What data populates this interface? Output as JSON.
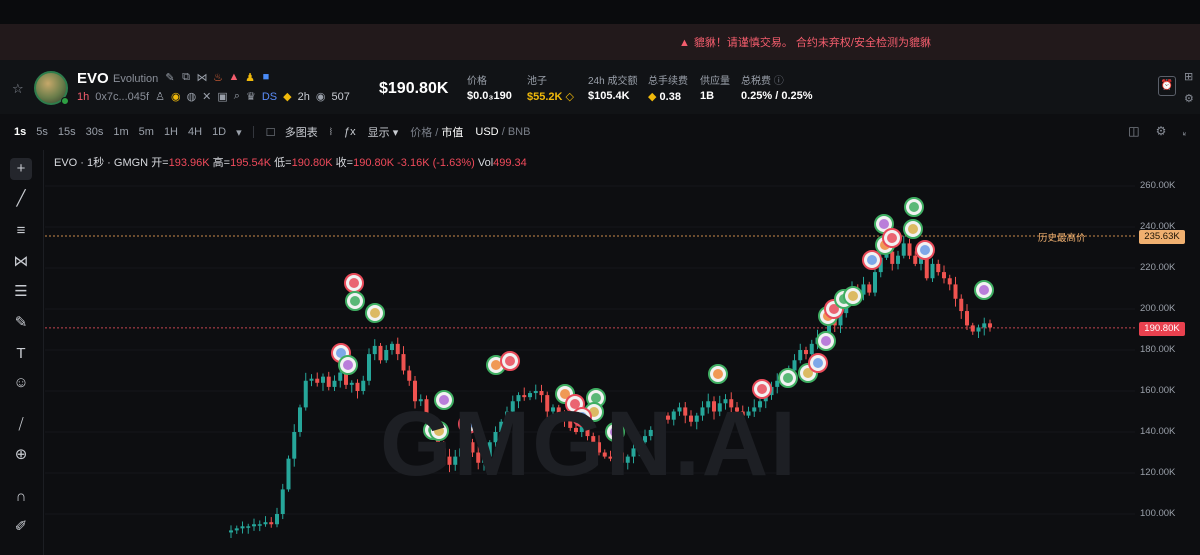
{
  "warning": {
    "icon": "warning-triangle-icon",
    "text": "貔貅！请谨慎交易。 合约未弃权/安全检测为貔貅"
  },
  "token": {
    "ticker": "EVO",
    "name": "Evolution",
    "age": "1h",
    "address": "0x7c...045f",
    "ds_label": "DS",
    "time": "2h",
    "views": "507",
    "market_cap": "$190.80K"
  },
  "stats": [
    {
      "label": "价格",
      "value": "$0.0₃190",
      "color": "#ffffff"
    },
    {
      "label": "池子",
      "value": "$55.2K",
      "color": "#f0b90b"
    },
    {
      "label": "24h 成交额",
      "value": "$105.4K",
      "color": "#ffffff"
    },
    {
      "label": "总手续费",
      "value": "0.38",
      "color": "#ffffff"
    },
    {
      "label": "供应量",
      "value": "1B",
      "color": "#ffffff"
    },
    {
      "label": "总税费",
      "value": "0.25% / 0.25%",
      "color": "#ffffff"
    }
  ],
  "toolbar": {
    "timeframes": [
      "1s",
      "5s",
      "15s",
      "30s",
      "1m",
      "5m",
      "1H",
      "4H",
      "1D"
    ],
    "active_timeframe": "1s",
    "multi_chart": "多图表",
    "display": "显示",
    "price_label": "价格",
    "mcap_label": "市值",
    "usd_label": "USD",
    "bnb_label": "BNB"
  },
  "legend": {
    "prefix": "EVO · 1秒 · GMGN",
    "open_label": "开=",
    "open": "193.96K",
    "high_label": "高=",
    "high": "195.54K",
    "low_label": "低=",
    "low": "190.80K",
    "close_label": "收=",
    "close": "190.80K",
    "change": "-3.16K (-1.63%)",
    "vol_label": "Vol",
    "vol": "499.34"
  },
  "watermark": "GMGN.AI",
  "chart_data": {
    "type": "candlestick",
    "y_unit": "market cap",
    "y_ticks": [
      "260.00K",
      "240.00K",
      "220.00K",
      "200.00K",
      "180.00K",
      "160.00K",
      "140.00K",
      "120.00K",
      "100.00K"
    ],
    "ath_label": "历史最高价",
    "ath_value": "235.63K",
    "current_value": "190.80K",
    "up_color": "#26a69a",
    "down_color": "#ef5350",
    "closes": [
      92,
      93,
      94,
      94,
      95,
      95,
      96,
      95,
      100,
      112,
      127,
      140,
      152,
      165,
      166,
      164,
      167,
      162,
      165,
      169,
      163,
      164,
      160,
      165,
      178,
      182,
      175,
      180,
      183,
      178,
      170,
      165,
      155,
      156,
      145,
      140,
      132,
      128,
      124,
      128,
      132,
      135,
      130,
      125,
      128,
      135,
      140,
      145,
      150,
      155,
      158,
      157,
      159,
      160,
      158,
      150,
      152,
      148,
      146,
      142,
      140,
      145,
      138,
      135,
      130,
      128,
      127,
      130,
      125,
      128,
      132,
      135,
      138,
      141,
      144,
      148,
      146,
      150,
      152,
      148,
      145,
      148,
      152,
      155,
      150,
      154,
      156,
      152,
      150,
      148,
      150,
      152,
      155,
      158,
      162,
      165,
      168,
      170,
      175,
      180,
      178,
      183,
      186,
      188,
      195,
      192,
      198,
      205,
      210,
      207,
      212,
      208,
      218,
      225,
      228,
      222,
      226,
      232,
      226,
      222,
      228,
      215,
      222,
      218,
      215,
      212,
      205,
      199,
      192,
      189,
      191,
      193,
      191
    ],
    "markers_count": 32
  }
}
